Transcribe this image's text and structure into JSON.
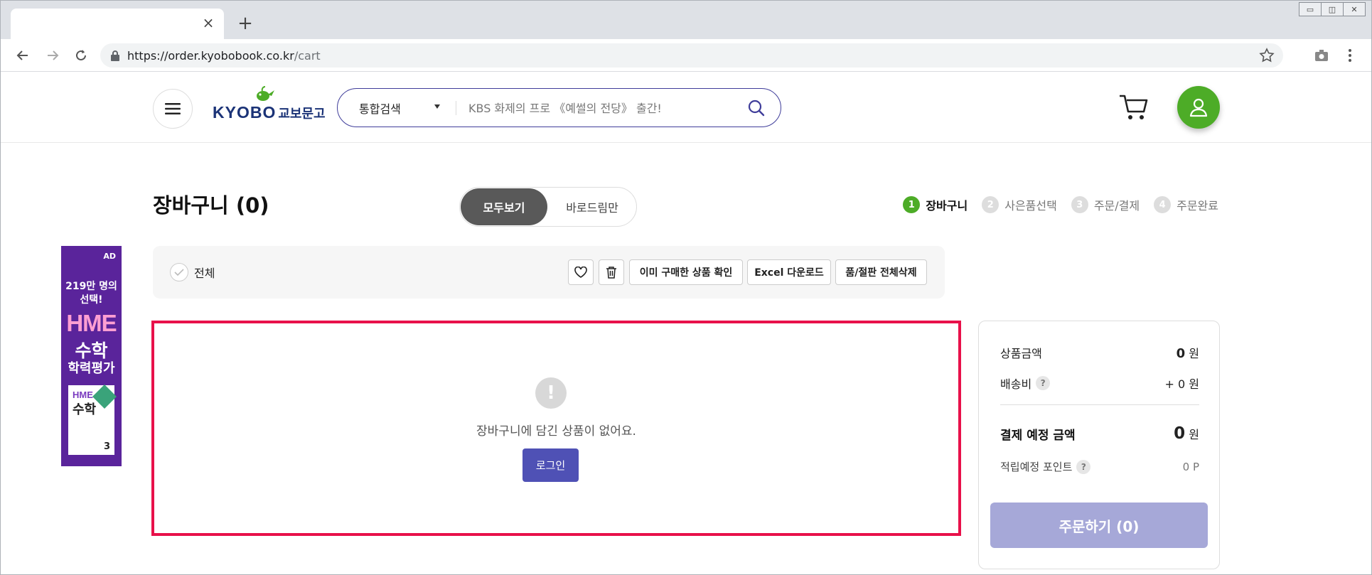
{
  "browser": {
    "tab_title": "",
    "tab_close": "×",
    "new_tab": "+",
    "url_host": "https://order.kyobobook.co.kr",
    "url_path": "/cart",
    "window_controls": [
      "▭",
      "◫",
      "✕"
    ]
  },
  "header": {
    "logo_text": "KYOBO",
    "logo_text_kr": "교보문고",
    "search_category": "통합검색",
    "search_placeholder": "KBS 화제의 프로 《예썰의 전당》 출간!",
    "brand_color": "#4dac27",
    "search_border_color": "#3f3d9a"
  },
  "page": {
    "title": "장바구니 (0)",
    "segment": {
      "all": "모두보기",
      "direct": "바로드림만"
    },
    "steps": [
      {
        "num": "1",
        "label": "장바구니",
        "active": true
      },
      {
        "num": "2",
        "label": "사은품선택",
        "active": false
      },
      {
        "num": "3",
        "label": "주문/결제",
        "active": false
      },
      {
        "num": "4",
        "label": "주문완료",
        "active": false
      }
    ]
  },
  "filter": {
    "select_all": "전체",
    "already_bought": "이미 구매한 상품 확인",
    "excel_download": "Excel 다운로드",
    "delete_out_of_stock": "품/절판 전체삭제"
  },
  "empty": {
    "icon": "!",
    "message": "장바구니에 담긴 상품이 없어요.",
    "login": "로그인"
  },
  "summary": {
    "product_amount_label": "상품금액",
    "product_amount_value": "0",
    "won": "원",
    "shipping_label": "배송비",
    "shipping_value": "+ 0 원",
    "payment_label": "결제 예정 금액",
    "payment_value": "0",
    "points_label": "적립예정 포인트",
    "points_value": "0 P",
    "help": "?",
    "order_button": "주문하기 (0)"
  },
  "ad": {
    "badge": "AD",
    "line1": "219만 명의",
    "line2": "선택!",
    "hme": "HME",
    "math": "수학",
    "test": "학력평가",
    "book_hme": "HME",
    "book_math": "수학",
    "book_grade": "3"
  }
}
